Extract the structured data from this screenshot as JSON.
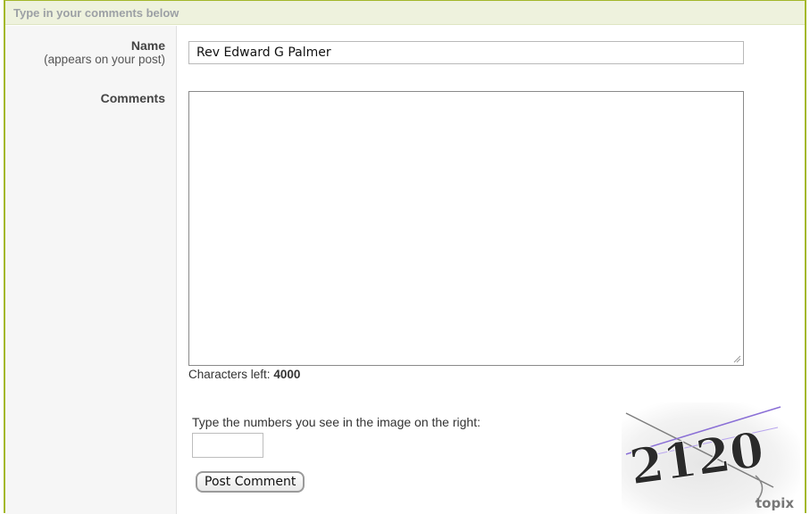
{
  "header": {
    "title": "Type in your comments below"
  },
  "form": {
    "name_label": "Name",
    "name_sublabel": "(appears on your post)",
    "name_value": "Rev Edward G Palmer",
    "comments_label": "Comments",
    "comments_value": "",
    "chars_left_prefix": "Characters left:",
    "chars_left_value": "4000",
    "captcha_prompt": "Type the numbers you see in the image on the right:",
    "captcha_value": "",
    "post_button": "Post Comment"
  },
  "captcha_image": {
    "digits": "2120",
    "brand": "topix"
  },
  "colors": {
    "frame": "#a3b82a",
    "header_bg": "#eef2dd",
    "captcha_line": "#8a6fd6"
  }
}
